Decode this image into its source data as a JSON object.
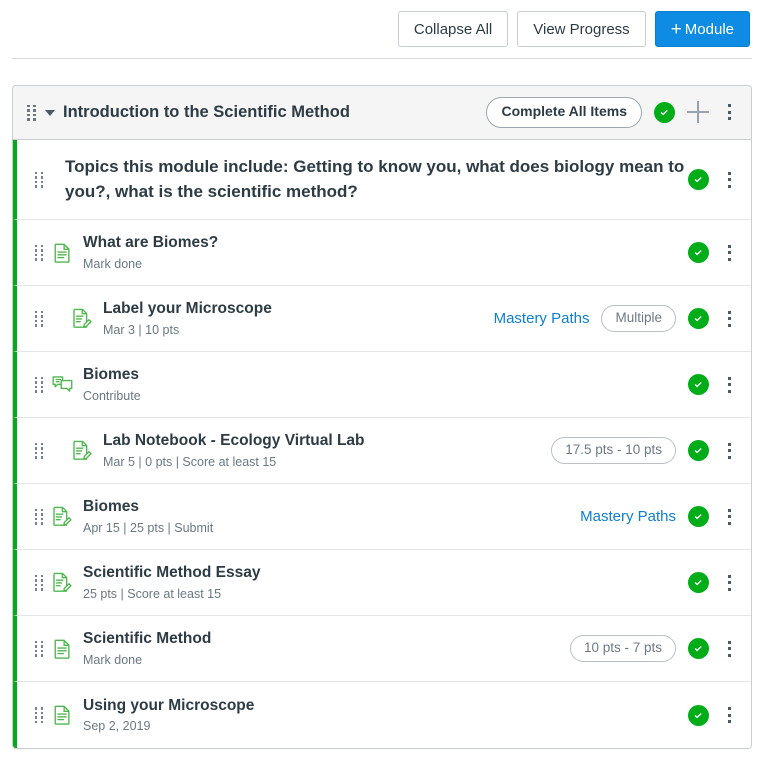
{
  "toolbar": {
    "collapse_all_label": "Collapse All",
    "view_progress_label": "View Progress",
    "add_module_label": "Module",
    "add_module_plus": "+"
  },
  "module": {
    "title": "Introduction to the Scientific Method",
    "complete_all_label": "Complete All Items",
    "completed_icon": "green-check-icon",
    "add_item_icon": "plus-icon",
    "options_icon": "kebab-menu-icon",
    "collapse_icon": "chevron-down-icon",
    "drag_icon": "drag-handle-icon"
  },
  "colors": {
    "primary_button": "#0e8ce4",
    "completed_green": "#00ac18",
    "module_bar_green": "#00ac18",
    "link_blue": "#0b7fd4",
    "header_bg": "#f5f5f5",
    "border": "#c7cdd1"
  },
  "items": [
    {
      "type": "text-header",
      "icon": "",
      "title": "Topics this module include: Getting to know you, what does biology mean to you?, what is the scientific method?",
      "subtitle": "",
      "mastery": "",
      "pill": "",
      "indent": 0,
      "completed": true
    },
    {
      "type": "page",
      "icon": "page-icon",
      "title": "What are Biomes?",
      "subtitle": "Mark done",
      "mastery": "",
      "pill": "",
      "indent": 0,
      "completed": true
    },
    {
      "type": "assignment",
      "icon": "assignment-icon",
      "title": "Label your Microscope",
      "subtitle": "Mar 3  |  10 pts",
      "mastery": "Mastery Paths",
      "pill": "Multiple",
      "indent": 1,
      "completed": true
    },
    {
      "type": "discussion",
      "icon": "discussion-icon",
      "title": "Biomes",
      "subtitle": "Contribute",
      "mastery": "",
      "pill": "",
      "indent": 0,
      "completed": true
    },
    {
      "type": "assignment",
      "icon": "assignment-icon",
      "title": "Lab Notebook - Ecology Virtual Lab",
      "subtitle": "Mar 5  |  0 pts  |  Score at least 15",
      "mastery": "",
      "pill": "17.5 pts - 10 pts",
      "indent": 1,
      "completed": true
    },
    {
      "type": "assignment",
      "icon": "assignment-icon",
      "title": "Biomes",
      "subtitle": "Apr 15  |  25 pts  |  Submit",
      "mastery": "Mastery Paths",
      "pill": "",
      "indent": 0,
      "completed": true
    },
    {
      "type": "assignment",
      "icon": "assignment-icon",
      "title": "Scientific Method Essay",
      "subtitle": "25 pts  |  Score at least 15",
      "mastery": "",
      "pill": "",
      "indent": 0,
      "completed": true
    },
    {
      "type": "page",
      "icon": "page-icon",
      "title": "Scientific Method",
      "subtitle": "Mark done",
      "mastery": "",
      "pill": "10 pts - 7 pts",
      "indent": 0,
      "completed": true
    },
    {
      "type": "page",
      "icon": "page-icon",
      "title": "Using your Microscope",
      "subtitle": "Sep 2, 2019",
      "mastery": "",
      "pill": "",
      "indent": 0,
      "completed": true
    }
  ]
}
